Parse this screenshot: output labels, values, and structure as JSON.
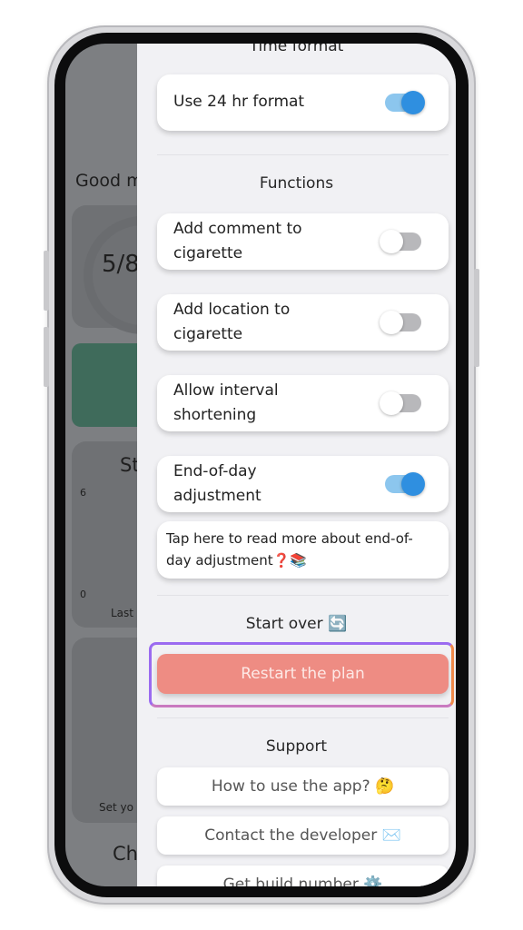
{
  "background_app": {
    "greeting": "Good m",
    "progress": "5/8",
    "stats_title": "St",
    "axis_top": "6",
    "axis_bottom": "0",
    "axis_caption": "Last",
    "set_caption": "Set yo",
    "bottom_title": "Ch"
  },
  "drawer": {
    "time_section_title": "Time format",
    "use_24hr_label": "Use 24 hr format",
    "use_24hr_on": true,
    "functions_title": "Functions",
    "toggles": [
      {
        "label_line1": "Add comment to",
        "label_line2": "cigarette",
        "on": false
      },
      {
        "label_line1": "Add location to",
        "label_line2": "cigarette",
        "on": false
      },
      {
        "label_line1": "Allow interval",
        "label_line2": "shortening",
        "on": false
      },
      {
        "label_line1": "End-of-day",
        "label_line2": "adjustment",
        "on": true
      }
    ],
    "info_link_line1": "Tap here to read more about end-of-",
    "info_link_line2": "day adjustment❓📚",
    "start_over_title": "Start over 🔄",
    "restart_button": "Restart the plan",
    "support_title": "Support",
    "support_buttons": [
      "How to use the app? 🤔",
      "Contact the developer ✉️",
      "Get build number ⚙️"
    ]
  },
  "colors": {
    "toggle_on_track": "#8cc6ee",
    "toggle_on_knob": "#2f8fe0",
    "restart_bg": "#ee8c83"
  }
}
